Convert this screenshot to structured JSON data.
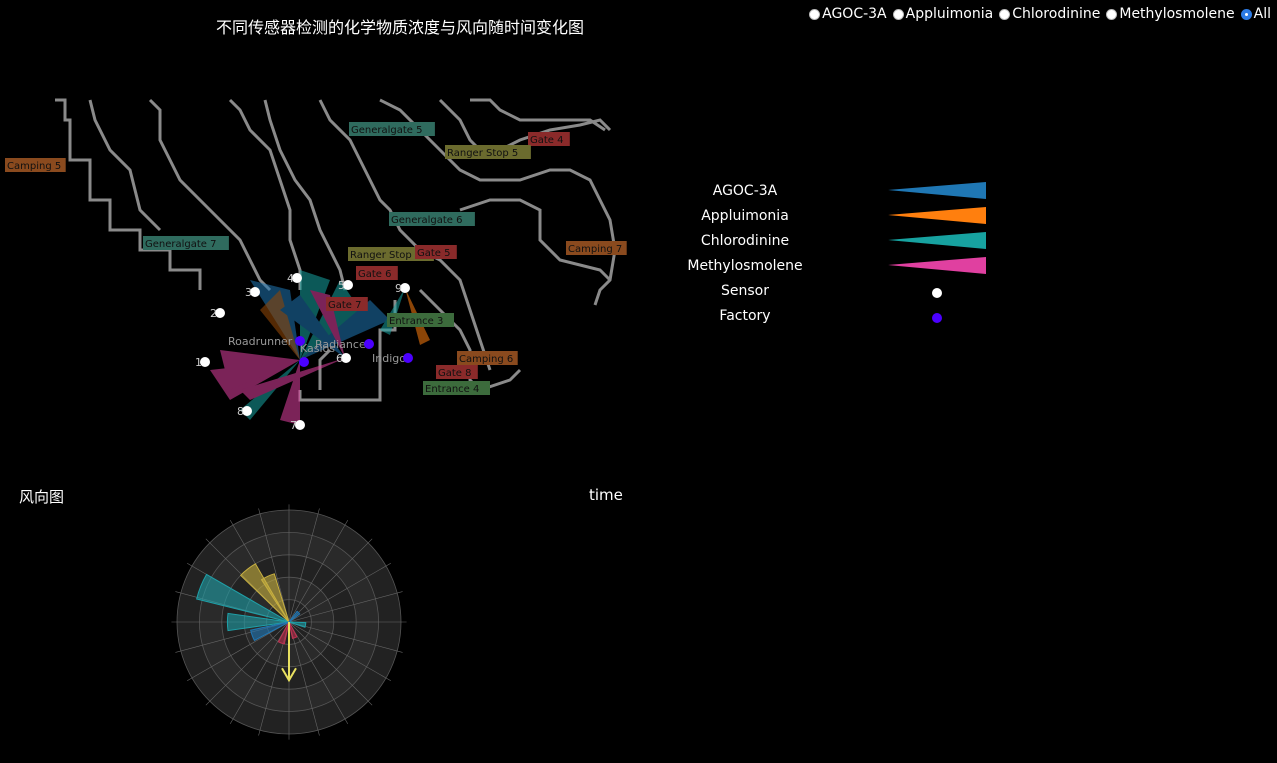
{
  "title": "不同传感器检测的化学物质浓度与风向随时间变化图",
  "radios": [
    {
      "label": "AGOC-3A",
      "selected": false
    },
    {
      "label": "Appluimonia",
      "selected": false
    },
    {
      "label": "Chlorodinine",
      "selected": false
    },
    {
      "label": "Methylosmolene",
      "selected": false
    },
    {
      "label": "All",
      "selected": true
    }
  ],
  "legend": [
    {
      "label": "AGOC-3A",
      "type": "wedge",
      "color": "#1f77b4"
    },
    {
      "label": "Appluimonia",
      "type": "wedge",
      "color": "#ff7f0e"
    },
    {
      "label": "Chlorodinine",
      "type": "wedge",
      "color": "#17a2a0"
    },
    {
      "label": "Methylosmolene",
      "type": "wedge",
      "color": "#e040a0"
    },
    {
      "label": "Sensor",
      "type": "dot",
      "color": "#ffffff"
    },
    {
      "label": "Factory",
      "type": "dot",
      "color": "#4b00ff"
    }
  ],
  "map_labels": [
    {
      "text": "Camping 5",
      "color": "#8a4a1e"
    },
    {
      "text": "Generalgate 5",
      "color": "#2f6b5e"
    },
    {
      "text": "Gate 4",
      "color": "#8a2a2a"
    },
    {
      "text": "Ranger Stop 5",
      "color": "#6b6b2e"
    },
    {
      "text": "Generalgate 6",
      "color": "#2f6b5e"
    },
    {
      "text": "Generalgate 7",
      "color": "#2f6b5e"
    },
    {
      "text": "Camping 7",
      "color": "#8a4a1e"
    },
    {
      "text": "Ranger Stop 6",
      "color": "#6b6b2e"
    },
    {
      "text": "Gate 5",
      "color": "#8a2a2a"
    },
    {
      "text": "Gate 6",
      "color": "#8a2a2a"
    },
    {
      "text": "Gate 7",
      "color": "#8a2a2a"
    },
    {
      "text": "Entrance 3",
      "color": "#3c6b3c"
    },
    {
      "text": "Camping 6",
      "color": "#8a4a1e"
    },
    {
      "text": "Gate 8",
      "color": "#8a2a2a"
    },
    {
      "text": "Entrance 4",
      "color": "#3c6b3c"
    }
  ],
  "factory_labels": [
    "Roadrunner",
    "Kasios",
    "Radiance",
    "Indigo"
  ],
  "sensors": [
    "1",
    "2",
    "3",
    "4",
    "5",
    "6",
    "7",
    "8",
    "9"
  ],
  "wind_title": "风向图",
  "time_title": "time",
  "wind_data": {
    "petals": [
      {
        "dir": 292,
        "r": 0.85,
        "color": "#1fa0a8"
      },
      {
        "dir": 270,
        "r": 0.55,
        "color": "#1fa0a8"
      },
      {
        "dir": 322,
        "r": 0.6,
        "color": "#c8b040"
      },
      {
        "dir": 335,
        "r": 0.45,
        "color": "#c8b040"
      },
      {
        "dir": 250,
        "r": 0.35,
        "color": "#1f77b4"
      },
      {
        "dir": 200,
        "r": 0.2,
        "color": "#c03050"
      },
      {
        "dir": 160,
        "r": 0.15,
        "color": "#c03050"
      },
      {
        "dir": 100,
        "r": 0.15,
        "color": "#1fa0a8"
      },
      {
        "dir": 45,
        "r": 0.12,
        "color": "#1f77b4"
      }
    ],
    "arrow_dir": 180,
    "arrow_color": "#e8e060"
  }
}
